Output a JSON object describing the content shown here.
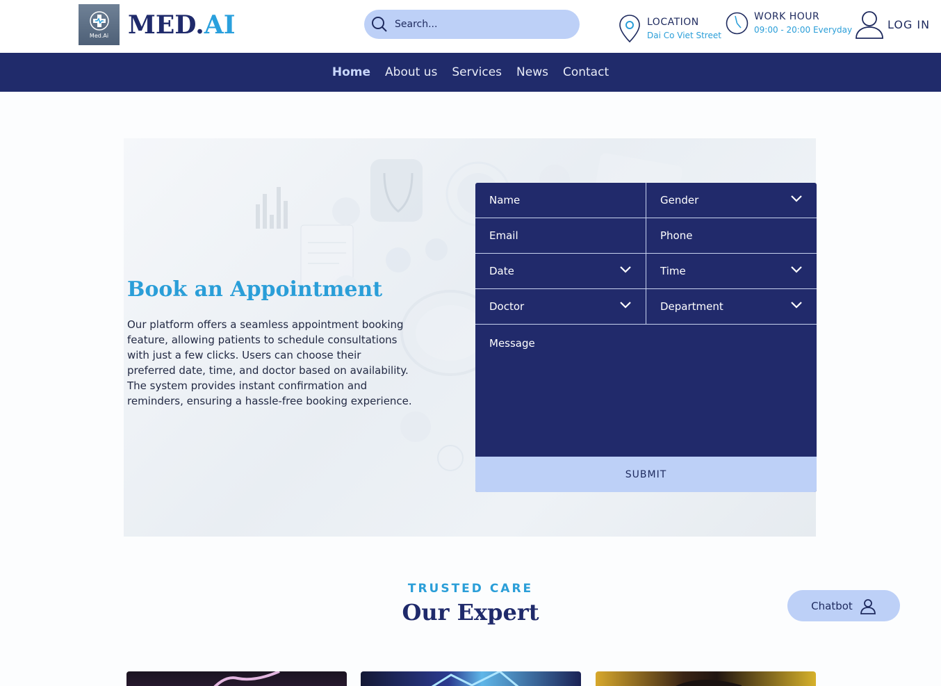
{
  "header": {
    "logo_small_text": "Med.Ai",
    "brand_main": "MED.",
    "brand_accent": "AI",
    "search_placeholder": "Search...",
    "location": {
      "label": "LOCATION",
      "value": "Dai Co Viet Street"
    },
    "work_hour": {
      "label": "WORK HOUR",
      "value": "09:00 - 20:00 Everyday"
    },
    "login_label": "LOG IN"
  },
  "nav": {
    "items": [
      {
        "label": "Home",
        "active": true
      },
      {
        "label": "About us"
      },
      {
        "label": "Services"
      },
      {
        "label": "News"
      },
      {
        "label": "Contact"
      }
    ]
  },
  "appointment": {
    "title": "Book an Appointment",
    "description": "Our platform offers a seamless appointment booking feature, allowing patients to schedule consultations with just a few clicks. Users can choose their preferred date, time, and doctor based on availability. The system provides instant confirmation and reminders, ensuring a hassle-free booking experience.",
    "form": {
      "name": "Name",
      "gender": "Gender",
      "email": "Email",
      "phone": "Phone",
      "date": "Date",
      "time": "Time",
      "doctor": "Doctor",
      "department": "Department",
      "message": "Message",
      "submit": "SUBMIT"
    }
  },
  "experts": {
    "kicker": "TRUSTED CARE",
    "title": "Our Expert"
  },
  "chatbot": {
    "label": "Chatbot"
  },
  "colors": {
    "navy": "#202b6b",
    "accent_blue": "#2a9ed8",
    "light_blue": "#bdd0f7"
  }
}
